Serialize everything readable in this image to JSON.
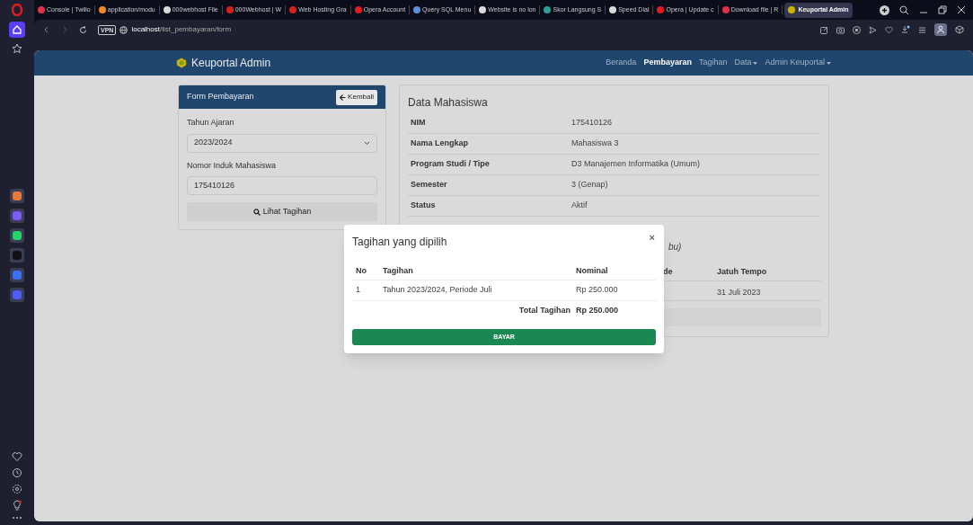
{
  "browser": {
    "tabs": [
      {
        "label": "Console | Twilio",
        "selected": false,
        "color": "#e0304a"
      },
      {
        "label": "application/modu",
        "selected": false,
        "color": "#f08a24"
      },
      {
        "label": "000webhost File",
        "selected": false,
        "color": "#d9d9d9"
      },
      {
        "label": "000Webhost | W",
        "selected": false,
        "color": "#d62020"
      },
      {
        "label": "Web Hosting Gra",
        "selected": false,
        "color": "#d62020"
      },
      {
        "label": "Opera Account",
        "selected": false,
        "color": "#e01b24"
      },
      {
        "label": "Query SQL Menu",
        "selected": false,
        "color": "#5b8fd9"
      },
      {
        "label": "Website is no lon",
        "selected": false,
        "color": "#d9d9d9"
      },
      {
        "label": "Skor Langsung S",
        "selected": false,
        "color": "#2aa198"
      },
      {
        "label": "Speed Dial",
        "selected": false,
        "color": "#d9d9d9"
      },
      {
        "label": "Opera | Update c",
        "selected": false,
        "color": "#e01b24"
      },
      {
        "label": "Download file | R",
        "selected": false,
        "color": "#e0304a"
      },
      {
        "label": "Keuportal Admin",
        "selected": true,
        "color": "#c9b400"
      }
    ],
    "address": {
      "vpn": "VPN",
      "host": "localhost",
      "path": "/list_pembayaran/form"
    }
  },
  "navbar": {
    "brand": "Keuportal Admin",
    "links": [
      {
        "label": "Beranda",
        "selected": false,
        "dropdown": false
      },
      {
        "label": "Pembayaran",
        "selected": true,
        "dropdown": false
      },
      {
        "label": "Tagihan",
        "selected": false,
        "dropdown": false
      },
      {
        "label": "Data",
        "selected": false,
        "dropdown": true
      },
      {
        "label": "Admin Keuportal",
        "selected": false,
        "dropdown": true
      }
    ]
  },
  "form": {
    "title": "Form Pembayaran",
    "back_button": "Kembali",
    "year_label": "Tahun Ajaran",
    "year_value": "2023/2024",
    "nim_label": "Nomor Induk Mahasiswa",
    "nim_value": "175410126",
    "submit": "Lihat Tagihan"
  },
  "student": {
    "title": "Data Mahasiswa",
    "rows": [
      {
        "label": "NIM",
        "value": "175410126"
      },
      {
        "label": "Nama Lengkap",
        "value": "Mahasiswa 3"
      },
      {
        "label": "Program Studi / Tipe",
        "value": "D3 Manajemen Informatika (Umum)"
      },
      {
        "label": "Semester",
        "value": "3 (Genap)"
      },
      {
        "label": "Status",
        "value": "Aktif"
      }
    ],
    "bill_note_fragment": "bu)",
    "bill_columns": [
      "de",
      "Jatuh Tempo"
    ],
    "bill_due": "31 Juli 2023"
  },
  "modal": {
    "title": "Tagihan yang dipilih",
    "close": "×",
    "columns": [
      "No",
      "Tagihan",
      "Nominal"
    ],
    "rows": [
      {
        "no": "1",
        "tagihan": "Tahun 2023/2024, Periode Juli",
        "nominal": "Rp 250.000"
      }
    ],
    "total_label": "Total Tagihan",
    "total_value": "Rp 250.000",
    "pay_button": "BAYAR"
  }
}
